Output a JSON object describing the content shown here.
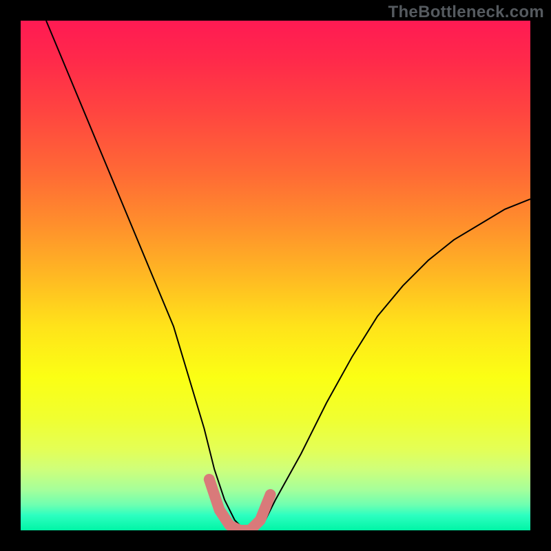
{
  "watermark": {
    "text": "TheBottleneck.com"
  },
  "chart_data": {
    "type": "line",
    "title": "",
    "xlabel": "",
    "ylabel": "",
    "xlim": [
      0,
      100
    ],
    "ylim": [
      0,
      100
    ],
    "grid": false,
    "legend": false,
    "background": {
      "type": "vertical-gradient",
      "stops": [
        {
          "pos": 0,
          "color": "#ff1a53"
        },
        {
          "pos": 50,
          "color": "#ffb823"
        },
        {
          "pos": 70,
          "color": "#fbff14"
        },
        {
          "pos": 100,
          "color": "#00f5a6"
        }
      ]
    },
    "series": [
      {
        "name": "bottleneck-curve",
        "color": "#000000",
        "stroke_width": 2,
        "x": [
          5,
          10,
          15,
          20,
          25,
          30,
          33,
          36,
          38,
          40,
          42,
          44,
          46,
          48,
          50,
          55,
          60,
          65,
          70,
          75,
          80,
          85,
          90,
          95,
          100
        ],
        "values": [
          100,
          88,
          76,
          64,
          52,
          40,
          30,
          20,
          12,
          6,
          2,
          0,
          0,
          2,
          6,
          15,
          25,
          34,
          42,
          48,
          53,
          57,
          60,
          63,
          65
        ]
      },
      {
        "name": "optimal-band-marker",
        "color": "#d97a7a",
        "stroke_width": 16,
        "stroke_linecap": "round",
        "x": [
          37,
          39,
          41,
          43,
          45,
          47,
          49
        ],
        "values": [
          10,
          4,
          1,
          0,
          0,
          2,
          7
        ]
      }
    ]
  }
}
